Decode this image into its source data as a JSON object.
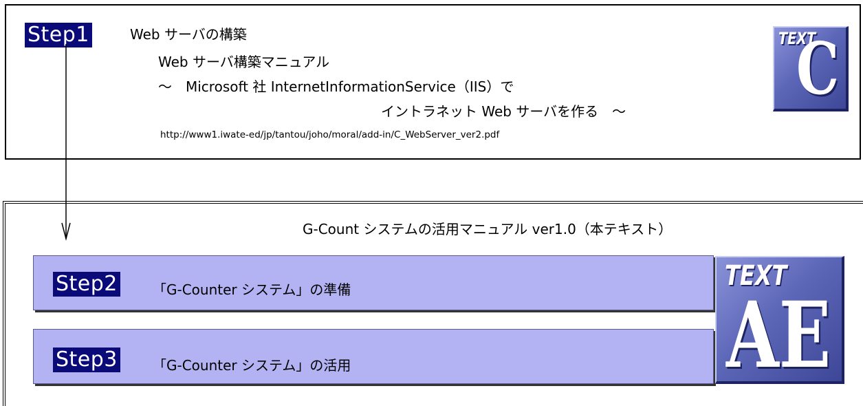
{
  "top": {
    "step_label": "Step1",
    "title": "Web サーバの構築",
    "subtitle": "Web サーバ構築マニュアル",
    "line3": "～　Microsoft 社 InternetInformationService（IIS）で",
    "line4": "イントラネット Web サーバを作る　～",
    "url": "http://www1.iwate-ed/jp/tantou/joho/moral/add-in/C_WebServer_ver2.pdf",
    "logo_small": "TEXT",
    "logo_big": "C"
  },
  "bottom": {
    "heading": "G-Count システムの活用マニュアル ver1.0（本テキスト）",
    "step2_label": "Step2",
    "step2_text": "「G-Counter システム」の準備",
    "step3_label": "Step3",
    "step3_text": "「G-Counter システム」の活用",
    "logo_small": "TEXT",
    "logo_big": "AE"
  },
  "colors": {
    "step_bg": "#0a0a78",
    "band_bg": "#b3b3f3",
    "logo_blue": "#5d67b8"
  }
}
